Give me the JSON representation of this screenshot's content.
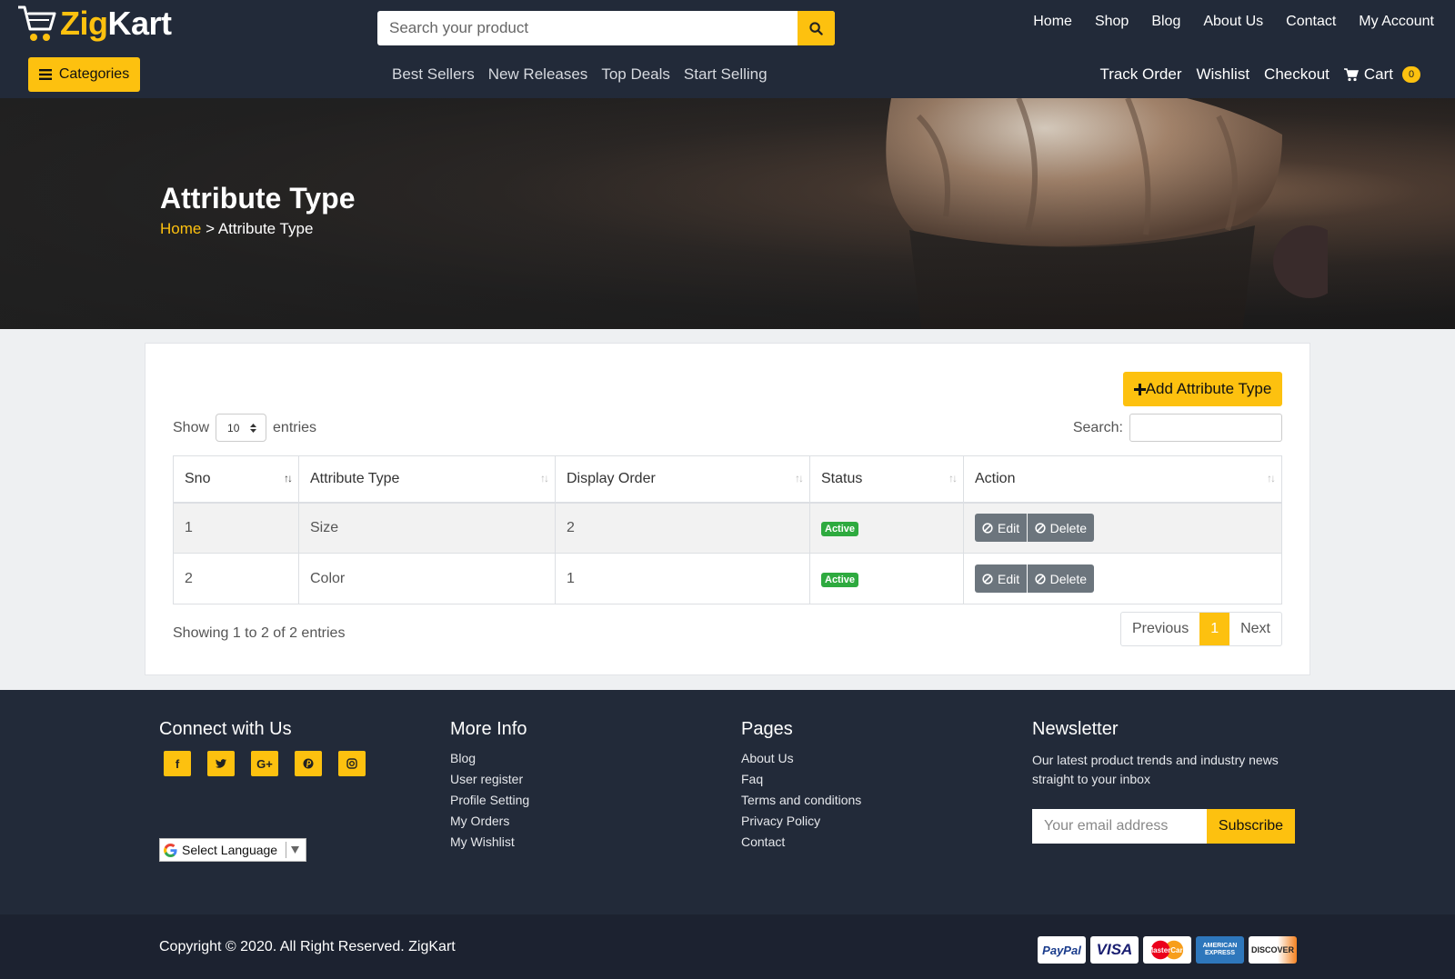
{
  "brand": {
    "name_part1": "Zig",
    "name_part2": "Kart"
  },
  "header": {
    "search_placeholder": "Search your product",
    "top_nav": [
      "Home",
      "Shop",
      "Blog",
      "About Us",
      "Contact",
      "My Account"
    ],
    "categories_label": "Categories",
    "sub_nav": [
      "Best Sellers",
      "New Releases",
      "Top Deals",
      "Start Selling"
    ],
    "right_nav": [
      "Track Order",
      "Wishlist",
      "Checkout"
    ],
    "cart_label": "Cart",
    "cart_count": "0"
  },
  "banner": {
    "title": "Attribute Type",
    "breadcrumb_home": "Home",
    "breadcrumb_sep": ">",
    "breadcrumb_current": "Attribute Type"
  },
  "content": {
    "add_button": "Add Attribute Type",
    "show_label": "Show",
    "entries_value": "10",
    "entries_label": "entries",
    "search_label": "Search:",
    "columns": [
      "Sno",
      "Attribute Type",
      "Display Order",
      "Status",
      "Action"
    ],
    "rows": [
      {
        "sno": "1",
        "type": "Size",
        "order": "2",
        "status": "Active"
      },
      {
        "sno": "2",
        "type": "Color",
        "order": "1",
        "status": "Active"
      }
    ],
    "edit_label": "Edit",
    "delete_label": "Delete",
    "info": "Showing 1 to 2 of 2 entries",
    "pager": {
      "prev": "Previous",
      "current": "1",
      "next": "Next"
    }
  },
  "footer": {
    "connect_title": "Connect with Us",
    "social_icons": [
      "facebook-icon",
      "twitter-icon",
      "google-plus-icon",
      "pinterest-icon",
      "instagram-icon"
    ],
    "language_label": "Select Language",
    "more_info_title": "More Info",
    "more_info_links": [
      "Blog",
      "User register",
      "Profile Setting",
      "My Orders",
      "My Wishlist"
    ],
    "pages_title": "Pages",
    "pages_links": [
      "About Us",
      "Faq",
      "Terms and conditions",
      "Privacy Policy",
      "Contact"
    ],
    "newsletter_title": "Newsletter",
    "newsletter_text": "Our latest product trends and industry news straight to your inbox",
    "email_placeholder": "Your email address",
    "subscribe_label": "Subscribe",
    "copyright": "Copyright © 2020. All Right Reserved. ZigKart",
    "payment_cards": [
      "PayPal",
      "VISA",
      "MasterCard",
      "AMERICAN EXPRESS",
      "DISCOVER"
    ]
  },
  "colors": {
    "accent": "#fdc10f",
    "header_bg": "#222a39",
    "active_badge": "#2eaa3f",
    "action_btn": "#6c757d"
  }
}
